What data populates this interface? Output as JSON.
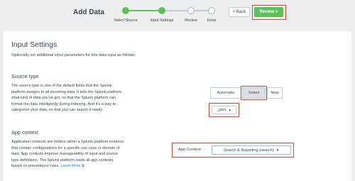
{
  "header": {
    "title": "Add Data",
    "steps": [
      {
        "label": "Select Source",
        "state": "done"
      },
      {
        "label": "Input Settings",
        "state": "done"
      },
      {
        "label": "Review",
        "state": "todo"
      },
      {
        "label": "Done",
        "state": "todo"
      }
    ],
    "back_label": "< Back",
    "review_label": "Review >"
  },
  "main": {
    "title": "Input Settings",
    "subtitle": "Optionally set additional input parameters for this data input as follows:",
    "source_type": {
      "heading": "Source type",
      "description_lines": [
        "The source type is one of the default fields that the Splunk",
        "platform assigns to all incoming data. It tells the Splunk platform",
        "what kind of data you've got, so that the Splunk platform can",
        "format the data intelligently during indexing. And it's a way to",
        "categorize your data, so that you can search it easily."
      ],
      "options": [
        "Automatic",
        "Select",
        "New"
      ],
      "selected_option": "Select",
      "value": "_json"
    },
    "app_context": {
      "heading": "App context",
      "description_lines": [
        "Application contexts are folders within a Splunk platform instance",
        "that contain configurations for a specific use case or domain of",
        "data. App contexts improve manageability of input and source",
        "type definitions. The Splunk platform loads all app contexts",
        "based on precedence rules."
      ],
      "learn_more": "Learn More",
      "field_label": "App Context",
      "value": "Search & Reporting (search)"
    }
  },
  "colors": {
    "accent_green": "#5cc05c",
    "highlight_red": "#e0402e",
    "link_blue": "#1a7fcf"
  }
}
